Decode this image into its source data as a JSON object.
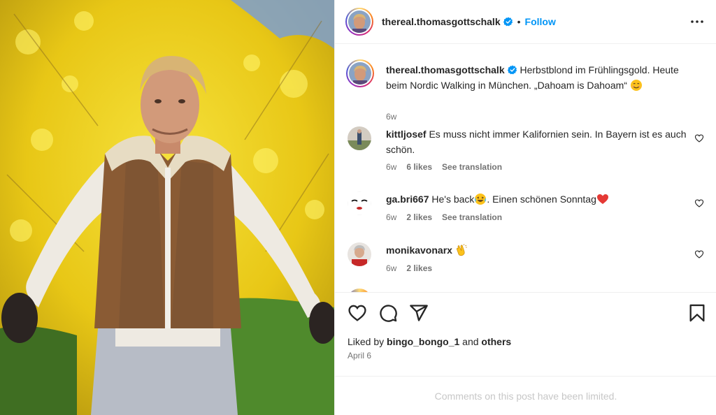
{
  "post": {
    "username": "thereal.thomasgottschalk",
    "follow_label": "Follow",
    "dot": "•",
    "caption": "Herbstblond im Frühlingsgold. Heute beim Nordic Walking in München. „Dahoam is Dahoam“",
    "caption_age": "6w",
    "likes_prefix": "Liked by",
    "likes_user": "bingo_bongo_1",
    "likes_and": "and",
    "likes_others": "others",
    "date": "April 6",
    "comments_limited": "Comments on this post have been limited."
  },
  "comments": [
    {
      "username": "kittljosef",
      "text": "Es muss nicht immer Kalifornien sein. In Bayern ist es auch schön.",
      "age": "6w",
      "likes": "6 likes",
      "translate": "See translation"
    },
    {
      "username": "ga.bri667",
      "text_a": "He's back",
      "text_b": ". Einen schönen Sonntag",
      "age": "6w",
      "likes": "2 likes",
      "translate": "See translation"
    },
    {
      "username": "monikavonarx",
      "age": "6w",
      "likes": "2 likes"
    }
  ],
  "colors": {
    "accent": "#0095f6",
    "muted": "#737373",
    "border": "#efefef",
    "disabled": "#c7c7c7"
  },
  "icons": [
    "verified-badge-icon",
    "more-options-icon",
    "heart-icon",
    "comment-icon",
    "share-icon",
    "bookmark-icon",
    "smiling-emoji-icon",
    "laughing-emoji-icon",
    "red-heart-emoji-icon",
    "clapping-hands-emoji-icon"
  ]
}
